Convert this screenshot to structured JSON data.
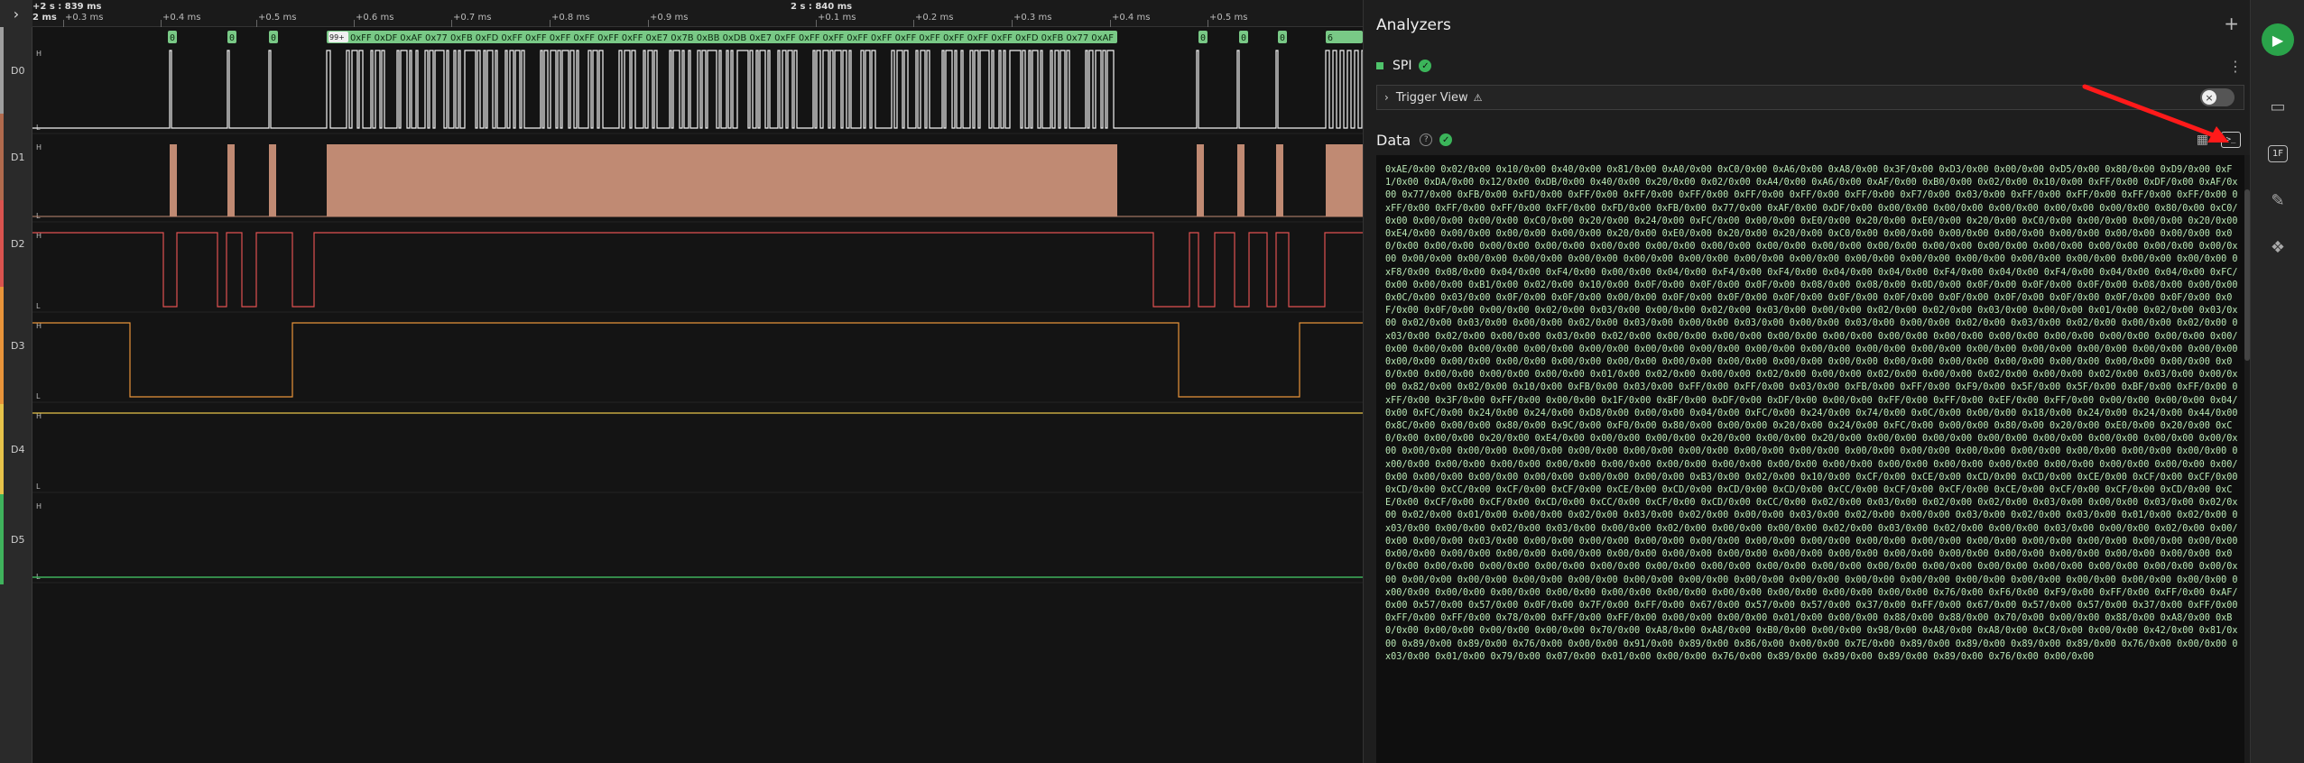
{
  "timebar": {
    "start_left": "+2 s : 839 ms",
    "start_left_sub": "2 ms",
    "center_marker": "2 s : 840 ms",
    "ticks": [
      "+0.3 ms",
      "+0.4 ms",
      "+0.5 ms",
      "+0.6 ms",
      "+0.7 ms",
      "+0.8 ms",
      "+0.9 ms",
      "+0.1 ms",
      "+0.2 ms",
      "+0.3 ms",
      "+0.4 ms",
      "+0.5 ms"
    ]
  },
  "channels": [
    {
      "name": "D0",
      "color": "#9e9e9e"
    },
    {
      "name": "D1",
      "color": "#b06a4d"
    },
    {
      "name": "D2",
      "color": "#d9534f"
    },
    {
      "name": "D3",
      "color": "#e8943a"
    },
    {
      "name": "D4",
      "color": "#e6c34a"
    },
    {
      "name": "D5",
      "color": "#3fb25c"
    }
  ],
  "level_labels": {
    "high": "H",
    "low": "L"
  },
  "bubbles": {
    "single": "0",
    "count": "99+",
    "hex_run": "0xFF 0xDF 0xAF 0x77 0xFB 0xFD 0xFF 0xFF 0xFF 0xFF 0xFF 0xFF 0xE7 0x7B 0xBB 0xDB 0xE7 0xFF 0xFF 0xFF 0xFF 0xFF 0xFF 0xFF 0xFF 0xFF 0xFF 0xFD 0xFB 0x77 0xAF",
    "tail": "6"
  },
  "panel": {
    "title": "Analyzers",
    "add_icon": "+",
    "analyzer_name": "SPI",
    "analyzer_menu": "⋮",
    "trigger_label": "Trigger View",
    "trigger_warn": "⚠",
    "data_title": "Data",
    "help": "?",
    "terminal_icon": ">_"
  },
  "data_stream": "0xAE/0x00 0x02/0x00 0x10/0x00 0x40/0x00 0x81/0x00 0xA0/0x00 0xC0/0x00 0xA6/0x00 0xA8/0x00 0x3F/0x00 0xD3/0x00 0x00/0x00 0xD5/0x00 0x80/0x00 0xD9/0x00 0xF1/0x00 0xDA/0x00 0x12/0x00 0xDB/0x00 0x40/0x00 0x20/0x00 0x02/0x00 0xA4/0x00 0xA6/0x00 0xAF/0x00 0xB0/0x00 0x02/0x00 0x10/0x00 0xFF/0x00 0xDF/0x00 0xAF/0x00 0x77/0x00 0xFB/0x00 0xFD/0x00 0xFF/0x00 0xFF/0x00 0xFF/0x00 0xFF/0x00 0xFF/0x00 0xFF/0x00 0xF7/0x00 0x03/0x00 0xFF/0x00 0xFF/0x00 0xFF/0x00 0xFF/0x00 0xFF/0x00 0xFF/0x00 0xFF/0x00 0xFF/0x00 0xFD/0x00 0xFB/0x00 0x77/0x00 0xAF/0x00 0xDF/0x00 0x00/0x00 0x00/0x00 0x00/0x00 0x00/0x00 0x00/0x00 0x80/0x00 0xC0/0x00 0x00/0x00 0x00/0x00 0xC0/0x00 0x20/0x00 0x24/0x00 0xFC/0x00 0x00/0x00 0xE0/0x00 0x20/0x00 0xE0/0x00 0x20/0x00 0xC0/0x00 0x00/0x00 0x00/0x00 0x20/0x00 0xE4/0x00 0x00/0x00 0x00/0x00 0x00/0x00 0x20/0x00 0xE0/0x00 0x20/0x00 0x20/0x00 0xC0/0x00 0x00/0x00 0x00/0x00 0x00/0x00 0x00/0x00 0x00/0x00 0x00/0x00 0x00/0x00 0x00/0x00 0x00/0x00 0x00/0x00 0x00/0x00 0x00/0x00 0x00/0x00 0x00/0x00 0x00/0x00 0x00/0x00 0x00/0x00 0x00/0x00 0x00/0x00 0x00/0x00 0x00/0x00 0x00/0x00 0x00/0x00 0x00/0x00 0x00/0x00 0x00/0x00 0x00/0x00 0x00/0x00 0x00/0x00 0x00/0x00 0x00/0x00 0x00/0x00 0x00/0x00 0x00/0x00 0x00/0x00 0x00/0x00 0x00/0x00 0xF8/0x00 0x08/0x00 0x04/0x00 0xF4/0x00 0x00/0x00 0x04/0x00 0xF4/0x00 0xF4/0x00 0x04/0x00 0x04/0x00 0xF4/0x00 0x04/0x00 0xF4/0x00 0x04/0x00 0x04/0x00 0xFC/0x00 0x00/0x00 0xB1/0x00 0x02/0x00 0x10/0x00 0x0F/0x00 0x0F/0x00 0x0F/0x00 0x08/0x00 0x08/0x00 0x0D/0x00 0x0F/0x00 0x0F/0x00 0x0F/0x00 0x08/0x00 0x00/0x00 0x0C/0x00 0x03/0x00 0x0F/0x00 0x0F/0x00 0x00/0x00 0x0F/0x00 0x0F/0x00 0x0F/0x00 0x0F/0x00 0x0F/0x00 0x0F/0x00 0x0F/0x00 0x0F/0x00 0x0F/0x00 0x0F/0x00 0x0F/0x00 0x0F/0x00 0x00/0x00 0x02/0x00 0x03/0x00 0x00/0x00 0x02/0x00 0x03/0x00 0x00/0x00 0x02/0x00 0x02/0x00 0x03/0x00 0x00/0x00 0x01/0x00 0x02/0x00 0x03/0x00 0x02/0x00 0x03/0x00 0x00/0x00 0x02/0x00 0x03/0x00 0x00/0x00 0x03/0x00 0x00/0x00 0x03/0x00 0x00/0x00 0x02/0x00 0x03/0x00 0x02/0x00 0x00/0x00 0x02/0x00 0x03/0x00 0x02/0x00 0x00/0x00 0x03/0x00 0x02/0x00 0x00/0x00 0x00/0x00 0x00/0x00 0x00/0x00 0x00/0x00 0x00/0x00 0x00/0x00 0x00/0x00 0x00/0x00 0x00/0x00 0x00/0x00 0x00/0x00 0x00/0x00 0x00/0x00 0x00/0x00 0x00/0x00 0x00/0x00 0x00/0x00 0x00/0x00 0x00/0x00 0x00/0x00 0x00/0x00 0x00/0x00 0x00/0x00 0x00/0x00 0x00/0x00 0x00/0x00 0x00/0x00 0x00/0x00 0x00/0x00 0x00/0x00 0x00/0x00 0x00/0x00 0x00/0x00 0x00/0x00 0x00/0x00 0x00/0x00 0x00/0x00 0x00/0x00 0x00/0x00 0x00/0x00 0x00/0x00 0x00/0x00 0x00/0x00 0x00/0x00 0x01/0x00 0x02/0x00 0x00/0x00 0x02/0x00 0x00/0x00 0x02/0x00 0x00/0x00 0x02/0x00 0x00/0x00 0x02/0x00 0x03/0x00 0x00/0x00 0x82/0x00 0x02/0x00 0x10/0x00 0xFB/0x00 0x03/0x00 0xFF/0x00 0xFF/0x00 0x03/0x00 0xFB/0x00 0xFF/0x00 0xF9/0x00 0x5F/0x00 0x5F/0x00 0xBF/0x00 0xFF/0x00 0xFF/0x00 0x3F/0x00 0xFF/0x00 0x00/0x00 0x1F/0x00 0xBF/0x00 0xDF/0x00 0xDF/0x00 0x00/0x00 0xFF/0x00 0xFF/0x00 0xEF/0x00 0xFF/0x00 0x00/0x00 0x00/0x00 0x04/0x00 0xFC/0x00 0x24/0x00 0x24/0x00 0xD8/0x00 0x00/0x00 0x04/0x00 0xFC/0x00 0x24/0x00 0x74/0x00 0x0C/0x00 0x00/0x00 0x18/0x00 0x24/0x00 0x24/0x00 0x44/0x00 0x8C/0x00 0x00/0x00 0x80/0x00 0x9C/0x00 0xF0/0x00 0x80/0x00 0x00/0x00 0x20/0x00 0x24/0x00 0xFC/0x00 0x00/0x00 0x80/0x00 0x20/0x00 0xE0/0x00 0x20/0x00 0xC0/0x00 0x00/0x00 0x20/0x00 0xE4/0x00 0x00/0x00 0x00/0x00 0x20/0x00 0x00/0x00 0x20/0x00 0x00/0x00 0x00/0x00 0x00/0x00 0x00/0x00 0x00/0x00 0x00/0x00 0x00/0x00 0x00/0x00 0x00/0x00 0x00/0x00 0x00/0x00 0x00/0x00 0x00/0x00 0x00/0x00 0x00/0x00 0x00/0x00 0x00/0x00 0x00/0x00 0x00/0x00 0x00/0x00 0x00/0x00 0x00/0x00 0x00/0x00 0x00/0x00 0x00/0x00 0x00/0x00 0x00/0x00 0x00/0x00 0x00/0x00 0x00/0x00 0x00/0x00 0x00/0x00 0x00/0x00 0x00/0x00 0x00/0x00 0x00/0x00 0x00/0x00 0x00/0x00 0x00/0x00 0x00/0x00 0x00/0x00 0x00/0x00 0x00/0x00 0xB3/0x00 0x02/0x00 0x10/0x00 0xCF/0x00 0xCE/0x00 0xCD/0x00 0xCD/0x00 0xCE/0x00 0xCF/0x00 0xCF/0x00 0xCD/0x00 0xCC/0x00 0xCF/0x00 0xCF/0x00 0xCE/0x00 0xCD/0x00 0xCD/0x00 0xCD/0x00 0xCC/0x00 0xCF/0x00 0xCF/0x00 0xCE/0x00 0xCF/0x00 0xCF/0x00 0xCD/0x00 0xCE/0x00 0xCF/0x00 0xCF/0x00 0xCD/0x00 0xCC/0x00 0xCF/0x00 0xCD/0x00 0xCC/0x00 0x02/0x00 0x03/0x00 0x02/0x00 0x02/0x00 0x03/0x00 0x00/0x00 0x03/0x00 0x02/0x00 0x02/0x00 0x01/0x00 0x00/0x00 0x02/0x00 0x03/0x00 0x02/0x00 0x00/0x00 0x03/0x00 0x02/0x00 0x00/0x00 0x03/0x00 0x02/0x00 0x03/0x00 0x01/0x00 0x02/0x00 0x03/0x00 0x00/0x00 0x02/0x00 0x03/0x00 0x00/0x00 0x02/0x00 0x00/0x00 0x00/0x00 0x02/0x00 0x03/0x00 0x02/0x00 0x00/0x00 0x03/0x00 0x00/0x00 0x02/0x00 0x00/0x00 0x00/0x00 0x03/0x00 0x00/0x00 0x00/0x00 0x00/0x00 0x00/0x00 0x00/0x00 0x00/0x00 0x00/0x00 0x00/0x00 0x00/0x00 0x00/0x00 0x00/0x00 0x00/0x00 0x00/0x00 0x00/0x00 0x00/0x00 0x00/0x00 0x00/0x00 0x00/0x00 0x00/0x00 0x00/0x00 0x00/0x00 0x00/0x00 0x00/0x00 0x00/0x00 0x00/0x00 0x00/0x00 0x00/0x00 0x00/0x00 0x00/0x00 0x00/0x00 0x00/0x00 0x00/0x00 0x00/0x00 0x00/0x00 0x00/0x00 0x00/0x00 0x00/0x00 0x00/0x00 0x00/0x00 0x00/0x00 0x00/0x00 0x00/0x00 0x00/0x00 0x00/0x00 0x00/0x00 0x00/0x00 0x00/0x00 0x00/0x00 0x00/0x00 0x00/0x00 0x00/0x00 0x00/0x00 0x00/0x00 0x00/0x00 0x00/0x00 0x00/0x00 0x00/0x00 0x00/0x00 0x00/0x00 0x00/0x00 0x00/0x00 0x00/0x00 0x00/0x00 0x00/0x00 0x00/0x00 0x00/0x00 0x00/0x00 0x00/0x00 0x00/0x00 0x76/0x00 0xF6/0x00 0xF9/0x00 0xFF/0x00 0xFF/0x00 0xAF/0x00 0x57/0x00 0x57/0x00 0x0F/0x00 0x7F/0x00 0xFF/0x00 0x67/0x00 0x57/0x00 0x57/0x00 0x37/0x00 0xFF/0x00 0x67/0x00 0x57/0x00 0x57/0x00 0x37/0x00 0xFF/0x00 0xFF/0x00 0xFF/0x00 0x78/0x00 0xFF/0x00 0xFF/0x00 0x00/0x00 0x00/0x00 0x01/0x00 0x00/0x00 0x88/0x00 0x88/0x00 0x70/0x00 0x00/0x00 0x88/0x00 0xA8/0x00 0xB0/0x00 0x00/0x00 0x00/0x00 0x00/0x00 0x70/0x00 0xA8/0x00 0xA8/0x00 0xB0/0x00 0x00/0x00 0x98/0x00 0xA8/0x00 0xA8/0x00 0xC8/0x00 0x00/0x00 0x42/0x00 0x81/0x00 0x89/0x00 0x89/0x00 0x76/0x00 0x00/0x00 0x91/0x00 0x89/0x00 0x86/0x00 0x00/0x00 0x7E/0x00 0x89/0x00 0x89/0x00 0x89/0x00 0x89/0x00 0x76/0x00 0x00/0x00 0x03/0x00 0x01/0x00 0x79/0x00 0x07/0x00 0x01/0x00 0x00/0x00 0x76/0x00 0x89/0x00 0x89/0x00 0x89/0x00 0x89/0x00 0x76/0x00 0x00/0x00"
}
